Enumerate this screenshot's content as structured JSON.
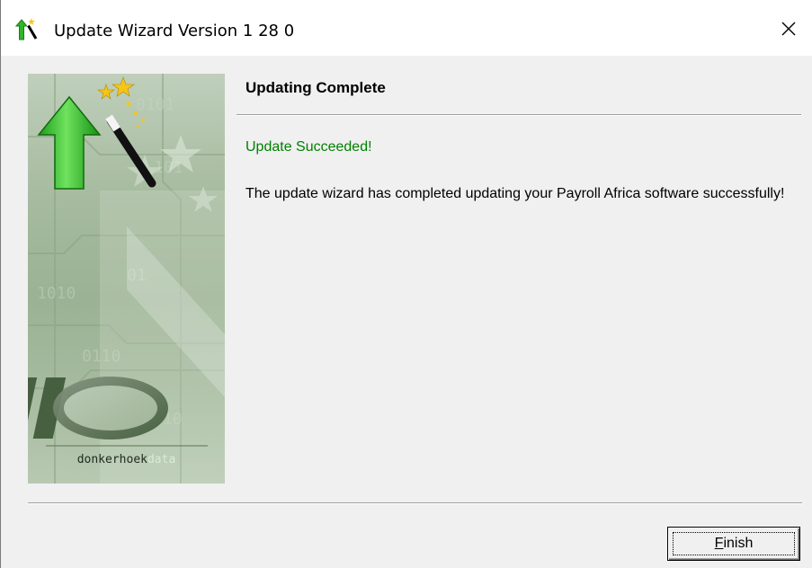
{
  "window": {
    "title": "Update Wizard Version 1 28 0",
    "icon": "magic-wand-update-icon"
  },
  "titlebar": {
    "close_icon": "close-icon",
    "close_label": "✕"
  },
  "banner": {
    "brand_primary": "donkerhoek",
    "brand_accent": "data",
    "arrow_icon": "green-up-arrow-icon",
    "logo_icon": "donkerhoekdata-logo-icon"
  },
  "page": {
    "heading": "Updating Complete",
    "status": "Update Succeeded!",
    "message": "The update wizard has completed updating your Payroll Africa software successfully!"
  },
  "buttons": {
    "finish_mnemonic": "F",
    "finish_rest": "inish"
  },
  "colors": {
    "success_text": "#008000",
    "dialog_bg": "#f0f0f0",
    "titlebar_bg": "#ffffff"
  }
}
